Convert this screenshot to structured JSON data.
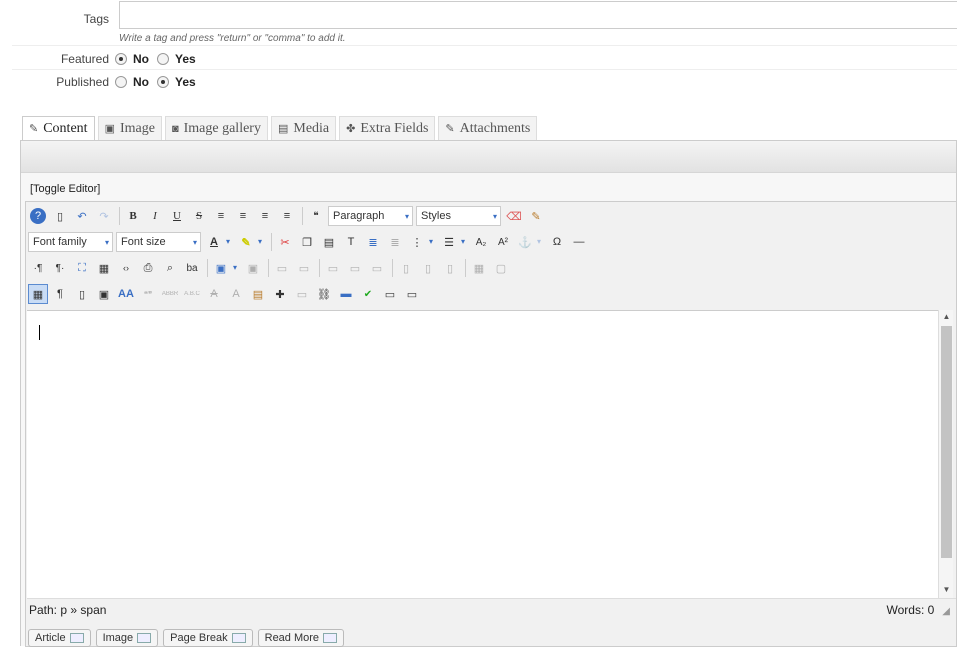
{
  "fields": {
    "tags_label": "Tags",
    "tags_value": "",
    "tags_help": "Write a tag and press \"return\" or \"comma\" to add it.",
    "featured_label": "Featured",
    "published_label": "Published",
    "no": "No",
    "yes": "Yes",
    "featured_value": "No",
    "published_value": "Yes"
  },
  "tabs": [
    {
      "label": "Content",
      "icon": "edit-icon"
    },
    {
      "label": "Image",
      "icon": "image-icon"
    },
    {
      "label": "Image gallery",
      "icon": "camera-icon"
    },
    {
      "label": "Media",
      "icon": "film-icon"
    },
    {
      "label": "Extra Fields",
      "icon": "puzzle-icon"
    },
    {
      "label": "Attachments",
      "icon": "paperclip-icon"
    }
  ],
  "editor": {
    "toggle": "[Toggle Editor]",
    "format": "Paragraph",
    "styles": "Styles",
    "font_family": "Font family",
    "font_size": "Font size",
    "path_label": "Path:",
    "path_value": "p » span",
    "words": "Words: 0"
  },
  "bottom_buttons": [
    "Article",
    "Image",
    "Page Break",
    "Read More"
  ],
  "colors": {
    "accent": "#3a6fc4",
    "thumb": "#c3c3c3"
  }
}
